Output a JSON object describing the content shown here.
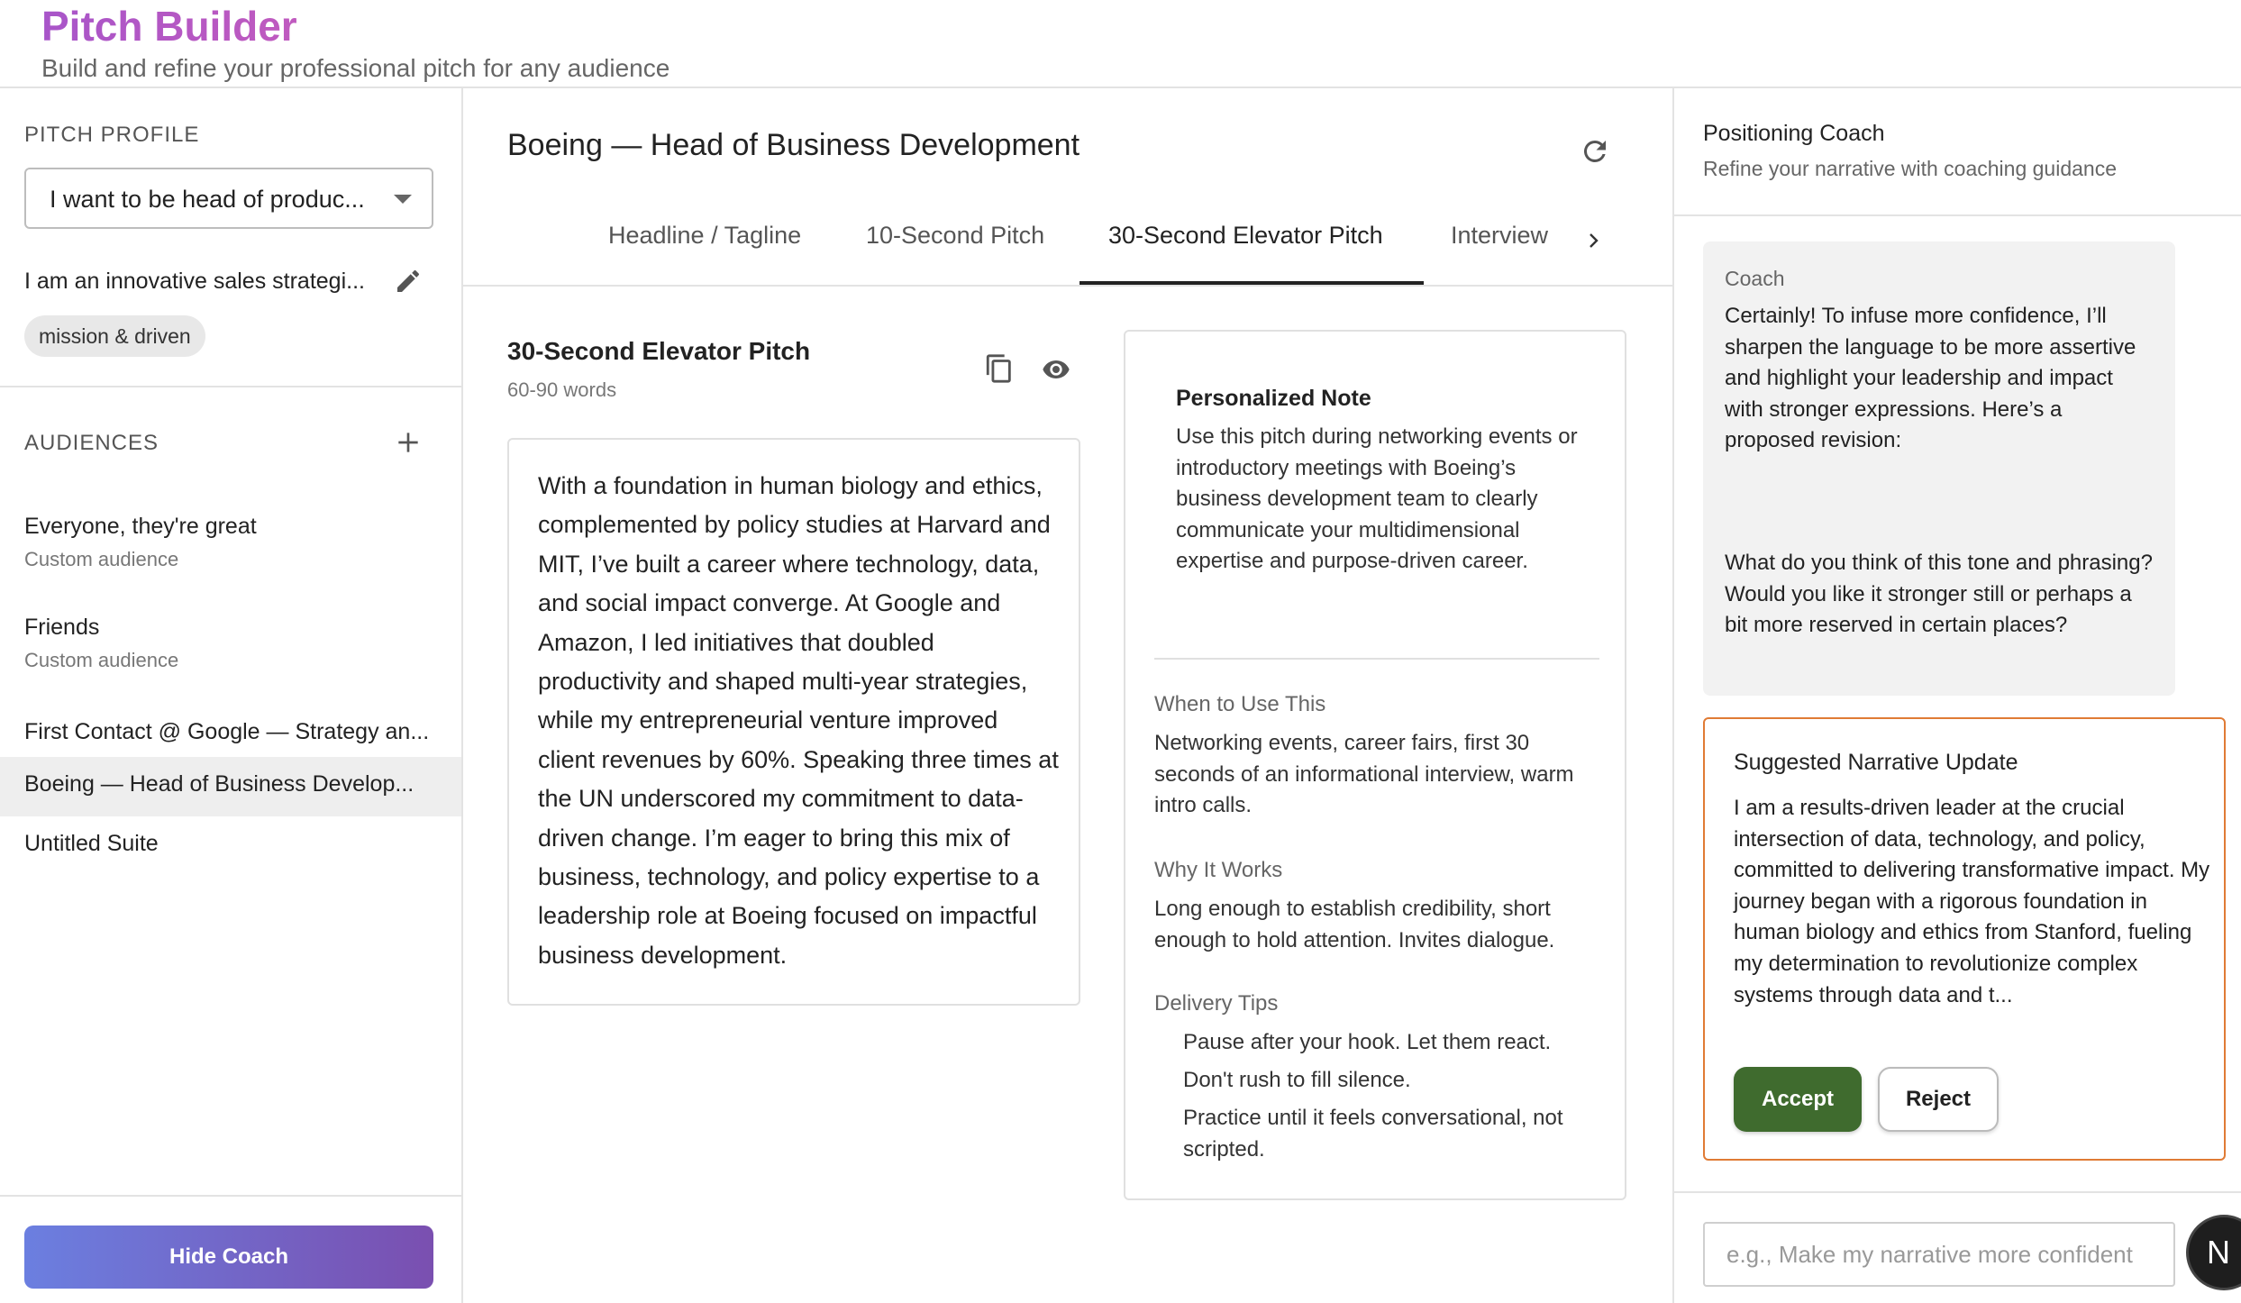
{
  "header": {
    "title": "Pitch Builder",
    "subtitle": "Build and refine your professional pitch for any audience"
  },
  "sidebar": {
    "profile_label": "PITCH PROFILE",
    "profile_select_value": "I want to be head of produc...",
    "profile_description": "I am an innovative sales strategi...",
    "chip": "mission & driven",
    "audiences_label": "AUDIENCES",
    "audiences": [
      {
        "name": "Everyone, they're great",
        "sub": "Custom audience"
      },
      {
        "name": "Friends",
        "sub": "Custom audience"
      },
      {
        "name": "First Contact @ Google — Strategy an..."
      },
      {
        "name": "Boeing — Head of Business Develop..."
      },
      {
        "name": "Untitled Suite"
      }
    ],
    "hide_coach_label": "Hide Coach"
  },
  "main": {
    "suite_title": "Boeing — Head of Business Development",
    "tabs": [
      "Headline / Tagline",
      "10-Second Pitch",
      "30-Second Elevator Pitch",
      "Interview"
    ],
    "active_tab": "30-Second Elevator Pitch",
    "pitch": {
      "title": "30-Second Elevator Pitch",
      "word_count": "60-90 words",
      "text": "With a foundation in human biology and ethics, complemented by policy studies at Harvard and MIT, I’ve built a career where technology, data, and social impact converge. At Google and Amazon, I led initiatives that doubled productivity and shaped multi-year strategies, while my entrepreneurial venture improved client revenues by 60%. Speaking three times at the UN underscored my commitment to data-driven change. I’m eager to bring this mix of business, technology, and policy expertise to a leadership role at Boeing focused on impactful business development."
    },
    "note": {
      "title": "Personalized Note",
      "body": "Use this pitch during networking events or introductory meetings with Boeing’s business development team to clearly communicate your multidimensional expertise and purpose-driven career.",
      "when_label": "When to Use This",
      "when_text": "Networking events, career fairs, first 30 seconds of an informational interview, warm intro calls.",
      "why_label": "Why It Works",
      "why_text": "Long enough to establish credibility, short enough to hold attention. Invites dialogue.",
      "tips_label": "Delivery Tips",
      "tips": [
        "Pause after your hook. Let them react.",
        "Don't rush to fill silence.",
        "Practice until it feels conversational, not scripted."
      ]
    }
  },
  "coach": {
    "title": "Positioning Coach",
    "subtitle": "Refine your narrative with coaching guidance",
    "message": {
      "sender": "Coach",
      "paragraph1": "Certainly! To infuse more confidence, I’ll sharpen the language to be more assertive and highlight your leadership and impact with stronger expressions. Here’s a proposed revision:",
      "paragraph2": "What do you think of this tone and phrasing? Would you like it stronger still or perhaps a bit more reserved in certain places?"
    },
    "suggestion": {
      "title": "Suggested Narrative Update",
      "text": "I am a results-driven leader at the crucial intersection of data, technology, and policy, committed to delivering transformative impact. My journey began with a rigorous foundation in human biology and ethics from Stanford, fueling my determination to revolutionize complex systems through data and t...",
      "accept_label": "Accept",
      "reject_label": "Reject"
    },
    "input_placeholder": "e.g., Make my narrative more confident",
    "avatar_letter": "N"
  },
  "colors": {
    "brand_gradient_start": "#a855c9",
    "accept_green": "#3f6b2e",
    "suggest_border": "#e07b35",
    "hide_coach_gradient": [
      "#6b7fe0",
      "#7a4fb0"
    ]
  }
}
